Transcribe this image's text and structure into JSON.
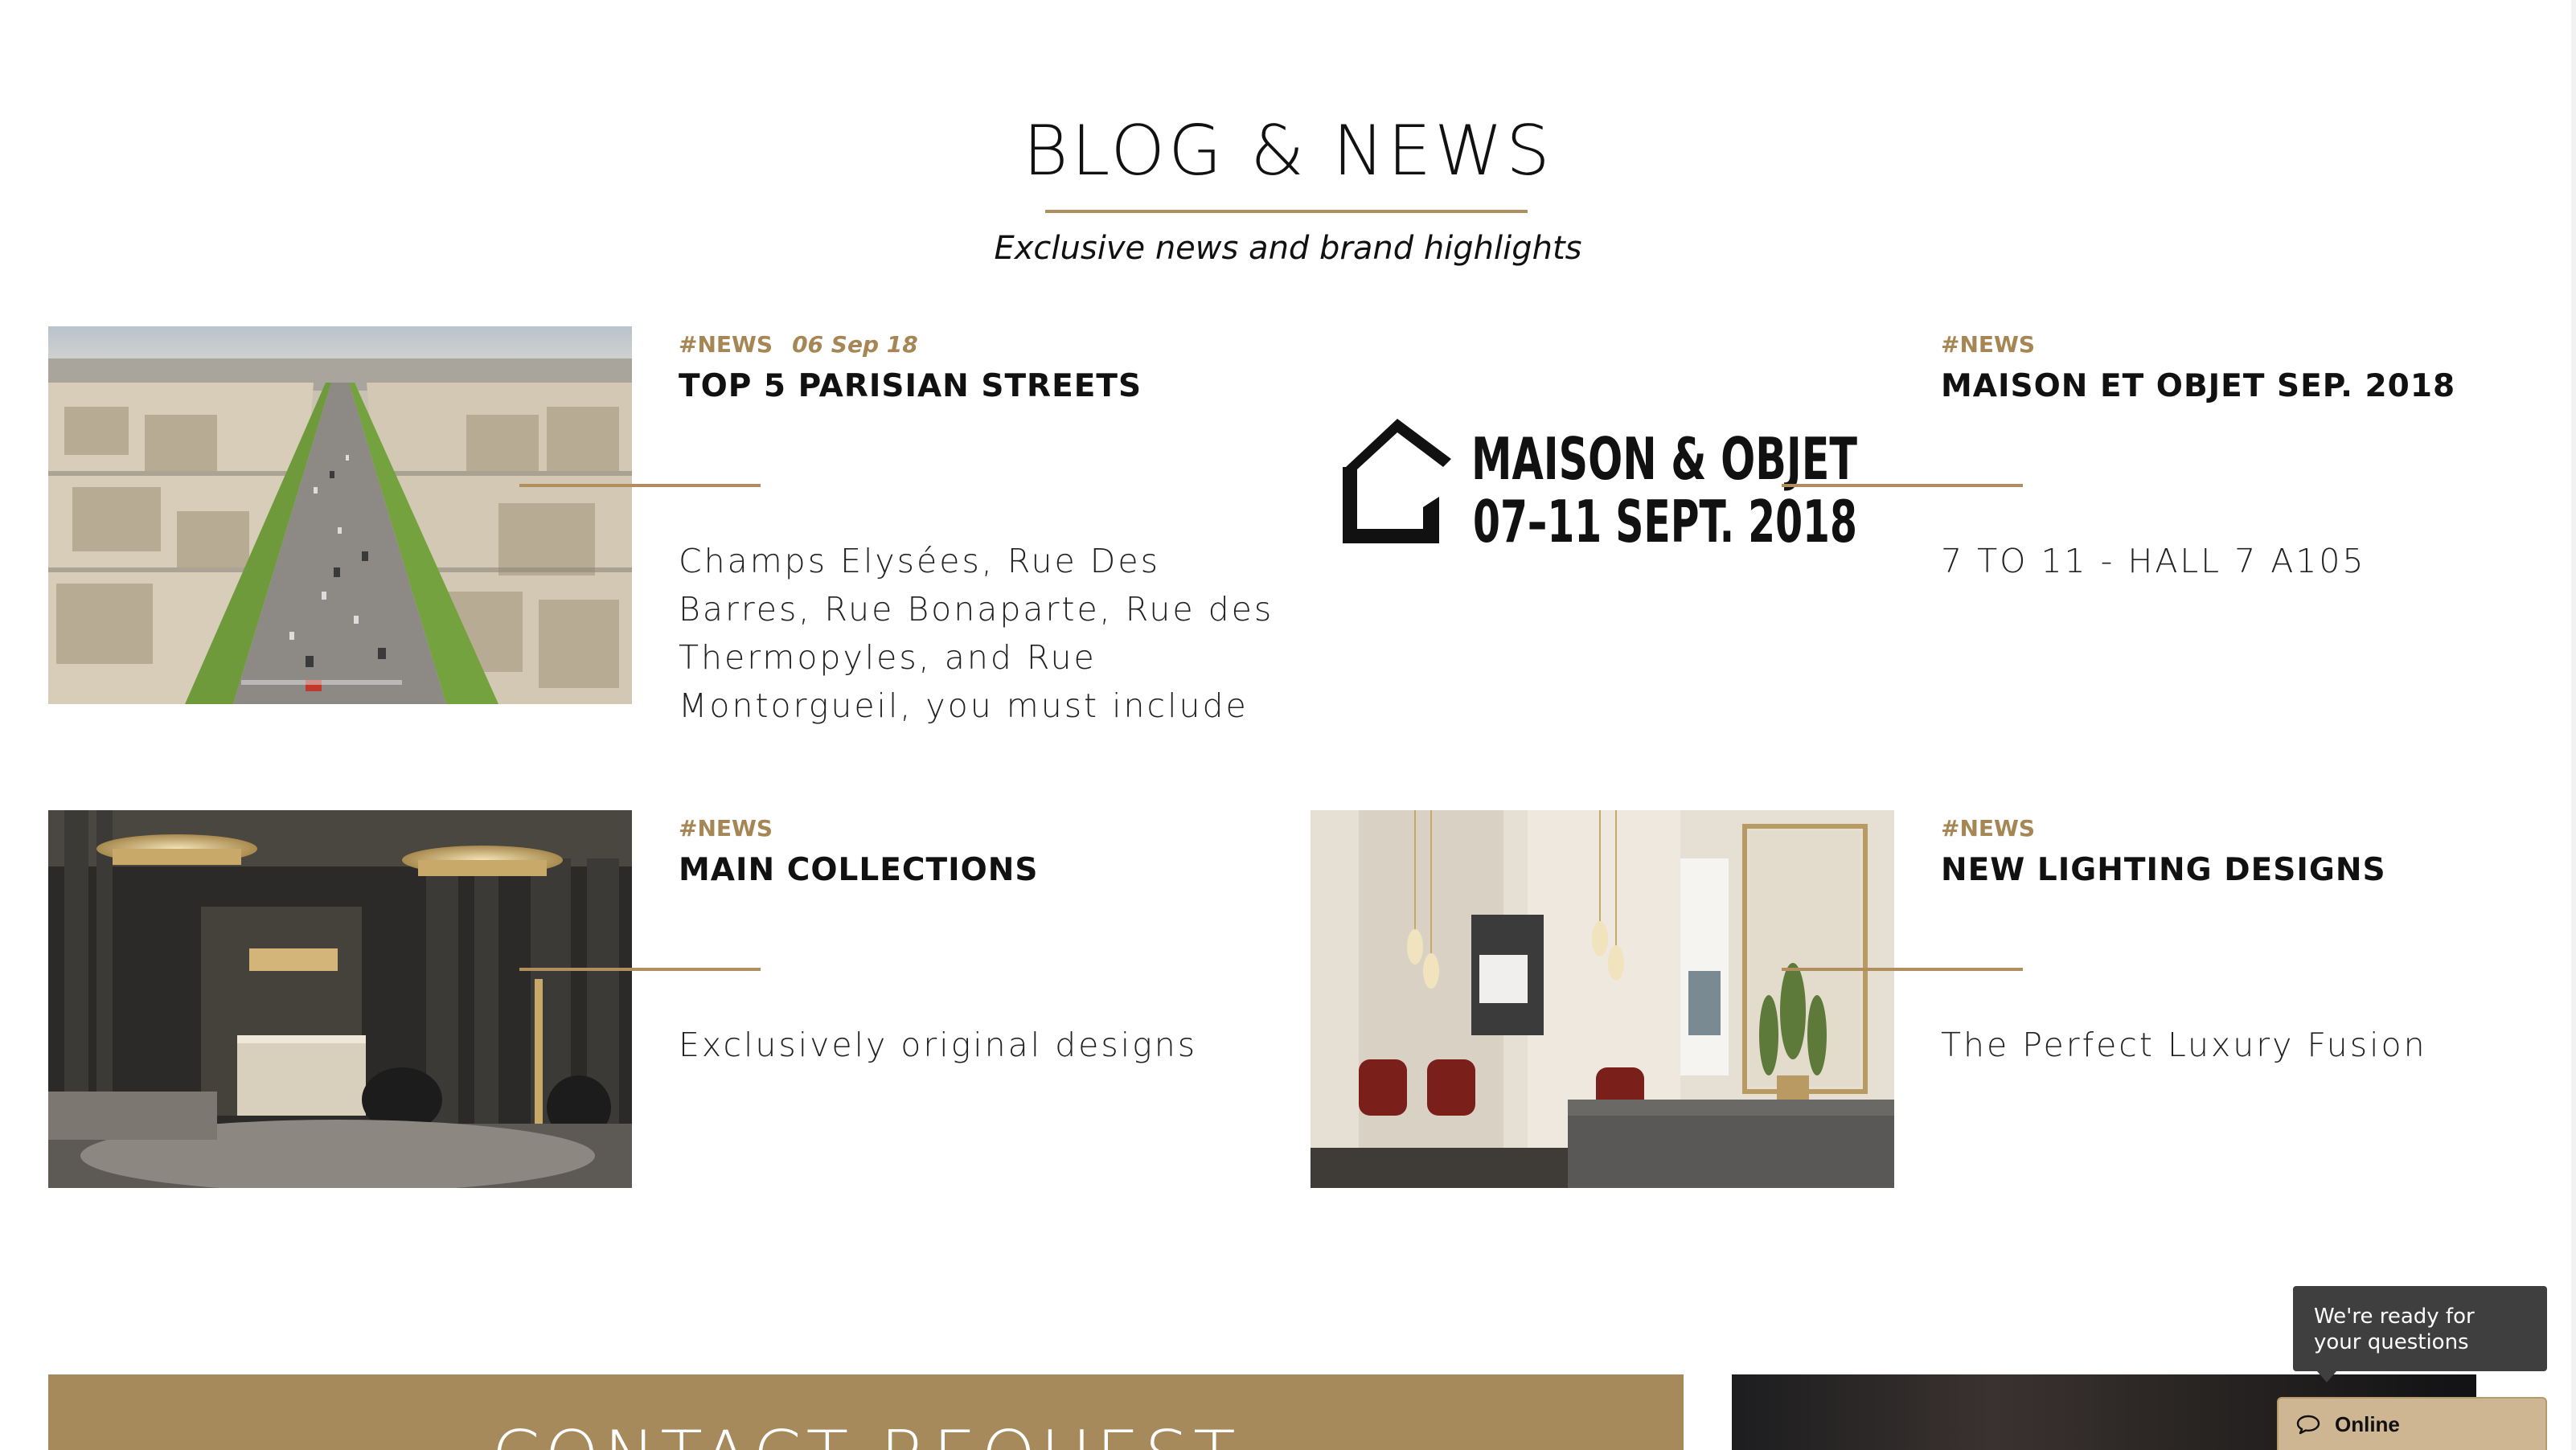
{
  "section": {
    "title": "BLOG & NEWS",
    "subtitle": "Exclusive news and brand highlights"
  },
  "posts": [
    {
      "tag": "#NEWS",
      "date": "06 Sep 18",
      "title": "TOP 5 PARISIAN STREETS",
      "excerpt": "Champs Elysées, Rue Des Barres, Rue Bonaparte, Rue des Thermopyles, and Rue Montorgueil, you must include",
      "image": "paris-avenue-aerial-photo"
    },
    {
      "tag": "#NEWS",
      "title": "MAISON ET OBJET SEP. 2018",
      "excerpt": "7 TO 11 - HALL 7 A105",
      "image": "maison-objet-logo",
      "logo_line1": "MAISON & OBJET",
      "logo_line2": "07–11 SEPT. 2018"
    },
    {
      "tag": "#NEWS",
      "title": "MAIN COLLECTIONS",
      "excerpt": "Exclusively original designs",
      "image": "luxury-lobby-photo"
    },
    {
      "tag": "#NEWS",
      "title": "NEW LIGHTING DESIGNS",
      "excerpt": "The Perfect Luxury Fusion",
      "image": "living-room-lighting-photo"
    }
  ],
  "contact": {
    "title": "CONTACT REQUEST"
  },
  "chat": {
    "bubble_text": "We're ready for your questions",
    "status_label": "Online",
    "icon": "chat-icon"
  },
  "colors": {
    "accent_gold": "#b08e5e",
    "tag_gold": "#a58654",
    "contact_band": "#a68a5c",
    "chat_bubble": "#3f3f3f",
    "chat_status": "#cdb691"
  }
}
